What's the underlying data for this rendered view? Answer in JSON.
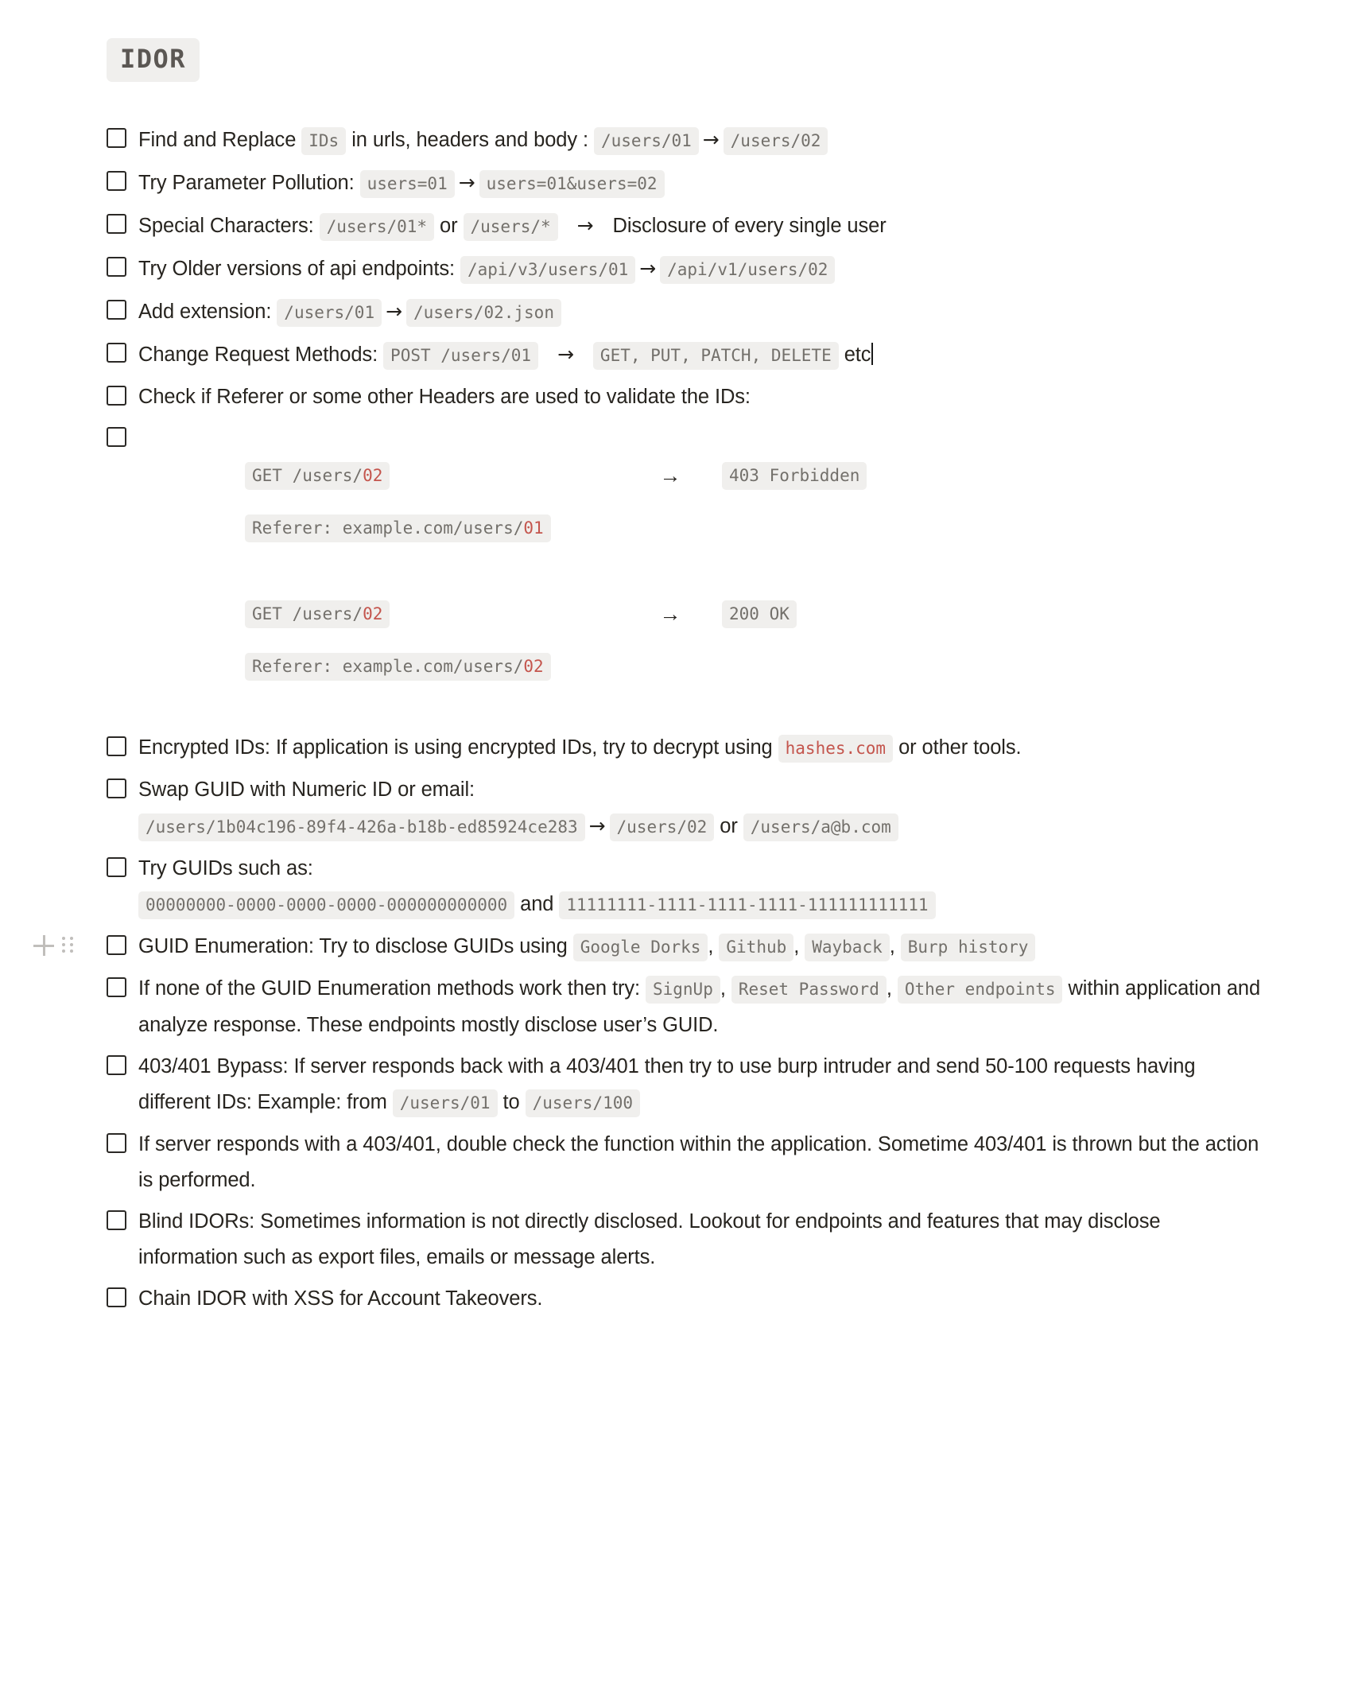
{
  "page": {
    "title": "IDOR"
  },
  "block_controls": {
    "add_icon": "plus-icon",
    "drag_icon": "drag-handle-icon"
  },
  "checklist": [
    {
      "id": "find-and-replace",
      "checked": false,
      "parts": [
        {
          "t": "text",
          "v": "Find and Replace "
        },
        {
          "t": "code",
          "v": "IDs"
        },
        {
          "t": "text",
          "v": " in urls, headers and body : "
        },
        {
          "t": "code",
          "v": "/users/01"
        },
        {
          "t": "arrow",
          "v": "→"
        },
        {
          "t": "code",
          "v": "/users/02"
        }
      ]
    },
    {
      "id": "parameter-pollution",
      "checked": false,
      "parts": [
        {
          "t": "text",
          "v": "Try Parameter Pollution: "
        },
        {
          "t": "code",
          "v": "users=01"
        },
        {
          "t": "arrow",
          "v": "→"
        },
        {
          "t": "code",
          "v": "users=01&users=02"
        }
      ]
    },
    {
      "id": "special-characters",
      "checked": false,
      "parts": [
        {
          "t": "text",
          "v": "Special Characters: "
        },
        {
          "t": "code",
          "v": "/users/01*"
        },
        {
          "t": "text",
          "v": " or "
        },
        {
          "t": "code",
          "v": "/users/*"
        },
        {
          "t": "arrow-wide",
          "v": "→"
        },
        {
          "t": "text",
          "v": "Disclosure of every single user"
        }
      ]
    },
    {
      "id": "older-api-versions",
      "checked": false,
      "parts": [
        {
          "t": "text",
          "v": "Try Older versions of api endpoints: "
        },
        {
          "t": "code",
          "v": "/api/v3/users/01"
        },
        {
          "t": "arrow",
          "v": "→"
        },
        {
          "t": "code",
          "v": "/api/v1/users/02"
        }
      ]
    },
    {
      "id": "add-extension",
      "checked": false,
      "parts": [
        {
          "t": "text",
          "v": "Add extension: "
        },
        {
          "t": "code",
          "v": "/users/01"
        },
        {
          "t": "arrow",
          "v": "→"
        },
        {
          "t": "code",
          "v": "/users/02.json"
        }
      ]
    },
    {
      "id": "change-request-methods",
      "checked": false,
      "parts": [
        {
          "t": "text",
          "v": "Change Request Methods: "
        },
        {
          "t": "code",
          "v": "POST /users/01"
        },
        {
          "t": "arrow-wide",
          "v": "→"
        },
        {
          "t": "code",
          "v": "GET, PUT, PATCH, DELETE"
        },
        {
          "t": "text",
          "v": " etc"
        },
        {
          "t": "caret",
          "v": ""
        }
      ]
    },
    {
      "id": "check-referer-headers",
      "checked": false,
      "parts": [
        {
          "t": "text",
          "v": "Check if Referer or some other Headers are used to validate the IDs:"
        }
      ]
    }
  ],
  "referer_example": {
    "checked": false,
    "groups": [
      {
        "request": {
          "prefix": "GET /users/",
          "highlight": "02"
        },
        "arrow": "→",
        "response": "403 Forbidden",
        "header": {
          "prefix": "Referer: example.com/users/",
          "highlight": "01"
        }
      },
      {
        "request": {
          "prefix": "GET /users/",
          "highlight": "02"
        },
        "arrow": "→",
        "response": "200 OK",
        "header": {
          "prefix": "Referer: example.com/users/",
          "highlight": "02"
        }
      }
    ]
  },
  "checklist2": [
    {
      "id": "encrypted-ids",
      "checked": false,
      "parts": [
        {
          "t": "text",
          "v": "Encrypted IDs: If application is using encrypted IDs, try to decrypt using "
        },
        {
          "t": "code-red",
          "v": "hashes.com"
        },
        {
          "t": "text",
          "v": " or other tools."
        }
      ]
    },
    {
      "id": "swap-guid",
      "checked": false,
      "parts": [
        {
          "t": "text",
          "v": "Swap GUID with Numeric ID or email:"
        },
        {
          "t": "br",
          "v": ""
        },
        {
          "t": "code",
          "v": "/users/1b04c196-89f4-426a-b18b-ed85924ce283"
        },
        {
          "t": "arrow",
          "v": "→"
        },
        {
          "t": "code",
          "v": "/users/02"
        },
        {
          "t": "text",
          "v": " or "
        },
        {
          "t": "code",
          "v": "/users/a@b.com"
        }
      ]
    },
    {
      "id": "try-guids",
      "checked": false,
      "parts": [
        {
          "t": "text",
          "v": "Try GUIDs such as:"
        },
        {
          "t": "br",
          "v": ""
        },
        {
          "t": "code",
          "v": "00000000-0000-0000-0000-000000000000"
        },
        {
          "t": "text",
          "v": " and "
        },
        {
          "t": "code",
          "v": "11111111-1111-1111-1111-111111111111"
        }
      ]
    },
    {
      "id": "guid-enumeration",
      "checked": false,
      "hovered": true,
      "parts": [
        {
          "t": "text",
          "v": "GUID Enumeration: Try to disclose GUIDs using "
        },
        {
          "t": "code",
          "v": "Google Dorks"
        },
        {
          "t": "text",
          "v": ", "
        },
        {
          "t": "code",
          "v": "Github"
        },
        {
          "t": "text",
          "v": ", "
        },
        {
          "t": "code",
          "v": "Wayback"
        },
        {
          "t": "text",
          "v": ", "
        },
        {
          "t": "code",
          "v": "Burp history"
        }
      ]
    },
    {
      "id": "guid-enum-fallback",
      "checked": false,
      "parts": [
        {
          "t": "text",
          "v": "If none of the GUID Enumeration methods work then try: "
        },
        {
          "t": "code",
          "v": "SignUp"
        },
        {
          "t": "text",
          "v": ", "
        },
        {
          "t": "code",
          "v": "Reset Password"
        },
        {
          "t": "text",
          "v": ", "
        },
        {
          "t": "code",
          "v": "Other endpoints"
        },
        {
          "t": "text",
          "v": " within application and analyze response. These endpoints mostly disclose user’s GUID."
        }
      ]
    },
    {
      "id": "403-401-bypass",
      "checked": false,
      "parts": [
        {
          "t": "text",
          "v": "403/401 Bypass: If server responds back with a 403/401 then try to use burp intruder and send 50-100 requests having different IDs: Example: from "
        },
        {
          "t": "code",
          "v": "/users/01"
        },
        {
          "t": "text",
          "v": " to "
        },
        {
          "t": "code",
          "v": "/users/100"
        }
      ]
    },
    {
      "id": "double-check-403",
      "checked": false,
      "parts": [
        {
          "t": "text",
          "v": "If server responds with a 403/401, double check the function within the application. Sometime 403/401 is thrown but the action is performed."
        }
      ]
    },
    {
      "id": "blind-idors",
      "checked": false,
      "parts": [
        {
          "t": "text",
          "v": "Blind IDORs: Sometimes information is not directly disclosed. Lookout for endpoints and features that may disclose information such as export files, emails or message alerts."
        }
      ]
    },
    {
      "id": "chain-idor-xss",
      "checked": false,
      "parts": [
        {
          "t": "text",
          "v": "Chain IDOR with XSS for Account Takeovers."
        }
      ]
    }
  ],
  "colors": {
    "code_bg": "#f0efed",
    "code_fg": "#73706b",
    "accent_red": "#c4554d",
    "text": "#27241f"
  }
}
